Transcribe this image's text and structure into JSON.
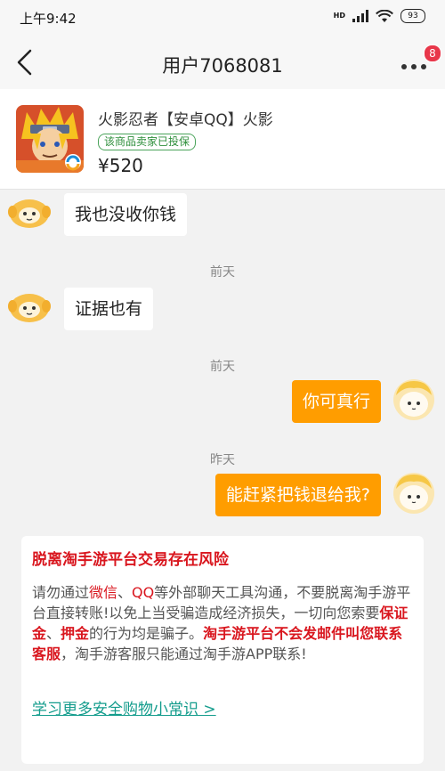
{
  "status_bar": {
    "time": "上午9:42",
    "network": "HD",
    "battery": "93"
  },
  "nav": {
    "title": "用户7068081",
    "badge_count": "8"
  },
  "product": {
    "title": "火影忍者【安卓QQ】火影",
    "tag": "该商品卖家已投保",
    "price": "¥520"
  },
  "messages": [
    {
      "direction": "in",
      "text": "我也没收你钱"
    },
    {
      "time": "前天"
    },
    {
      "direction": "in",
      "text": "证据也有"
    },
    {
      "time": "前天"
    },
    {
      "direction": "out",
      "text": "你可真行"
    },
    {
      "time": "昨天"
    },
    {
      "direction": "out",
      "text": "能赶紧把钱退给我?"
    }
  ],
  "warning": {
    "title": "脱离淘手游平台交易存在风险",
    "body": [
      {
        "text": "请勿通过",
        "style": "normal"
      },
      {
        "text": "微信",
        "style": "red"
      },
      {
        "text": "、",
        "style": "normal"
      },
      {
        "text": "QQ",
        "style": "red"
      },
      {
        "text": "等外部聊天工具沟通，不要脱离淘手游平台直接转账!以免上当受骗造成经济损失，一切向您索要",
        "style": "normal"
      },
      {
        "text": "保证金",
        "style": "red-bold"
      },
      {
        "text": "、",
        "style": "normal"
      },
      {
        "text": "押金",
        "style": "red-bold"
      },
      {
        "text": "的行为均是骗子。",
        "style": "normal"
      },
      {
        "text": "淘手游平台不会发邮件叫您联系客服",
        "style": "red-bold"
      },
      {
        "text": "，淘手游客服只能通过淘手游APP联系!",
        "style": "normal"
      }
    ],
    "link": "学习更多安全购物小常识 >"
  },
  "colors": {
    "accent_orange": "#ff9d00",
    "warning_red": "#d9161e",
    "link_teal": "#139c8c",
    "badge_red": "#e8374a",
    "insured_green": "#2f8f3c"
  },
  "icons": {
    "back": "chevron-left-icon",
    "more": "more-dots-icon",
    "signal": "signal-icon",
    "wifi": "wifi-icon",
    "battery": "battery-icon"
  }
}
